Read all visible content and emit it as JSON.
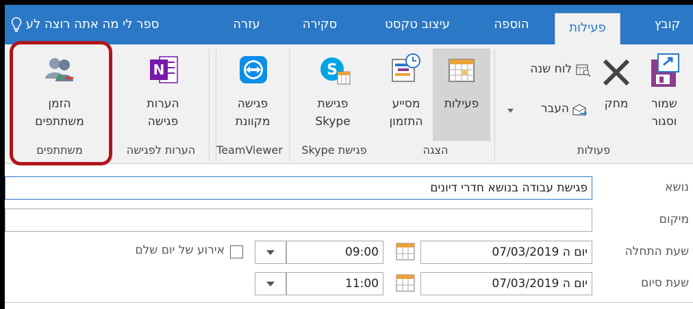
{
  "tabs": [
    {
      "label": "קובץ",
      "active": false
    },
    {
      "label": "פעילות",
      "active": true
    },
    {
      "label": "הוספה",
      "active": false
    },
    {
      "label": "עיצוב טקסט",
      "active": false
    },
    {
      "label": "סקירה",
      "active": false
    },
    {
      "label": "עזרה",
      "active": false
    }
  ],
  "tell_me": "ספר לי מה אתה רוצה לע",
  "ribbon": {
    "actions": {
      "save_close_1": "שמור",
      "save_close_2": "וסגור",
      "delete": "מחק",
      "calendar": "לוח שנה",
      "forward": "העבר",
      "group": "פעולות"
    },
    "view": {
      "activities": "פעילות",
      "assistant_1": "מסייע",
      "assistant_2": "התזמון",
      "group": "הצגה"
    },
    "skype": {
      "line1": "פגישת",
      "line2": "Skype",
      "group": "פגישת Skype"
    },
    "teamviewer": {
      "line1": "פגישה",
      "line2": "מקוונת",
      "group": "TeamViewer"
    },
    "notes": {
      "line1": "הערות",
      "line2": "פגישה",
      "group": "הערות לפגישה"
    },
    "attendees": {
      "line1": "הזמן",
      "line2": "משתתפים",
      "group": "משתתפים"
    }
  },
  "form": {
    "subject_label": "נושא",
    "subject_value": "פגישת עבודה בנושא חדרי דיונים",
    "location_label": "מיקום",
    "location_value": "",
    "start_label": "שעת התחלה",
    "start_date": "יום ה 07/03/2019",
    "start_time": "09:00",
    "all_day_label": "אירוע של יום שלם",
    "end_label": "שעת סיום",
    "end_date": "יום ה 07/03/2019",
    "end_time": "11:00"
  },
  "colors": {
    "tab_bar": "#2b78c6",
    "ribbon": "#f1f1f1",
    "highlight": "#b0151b"
  }
}
